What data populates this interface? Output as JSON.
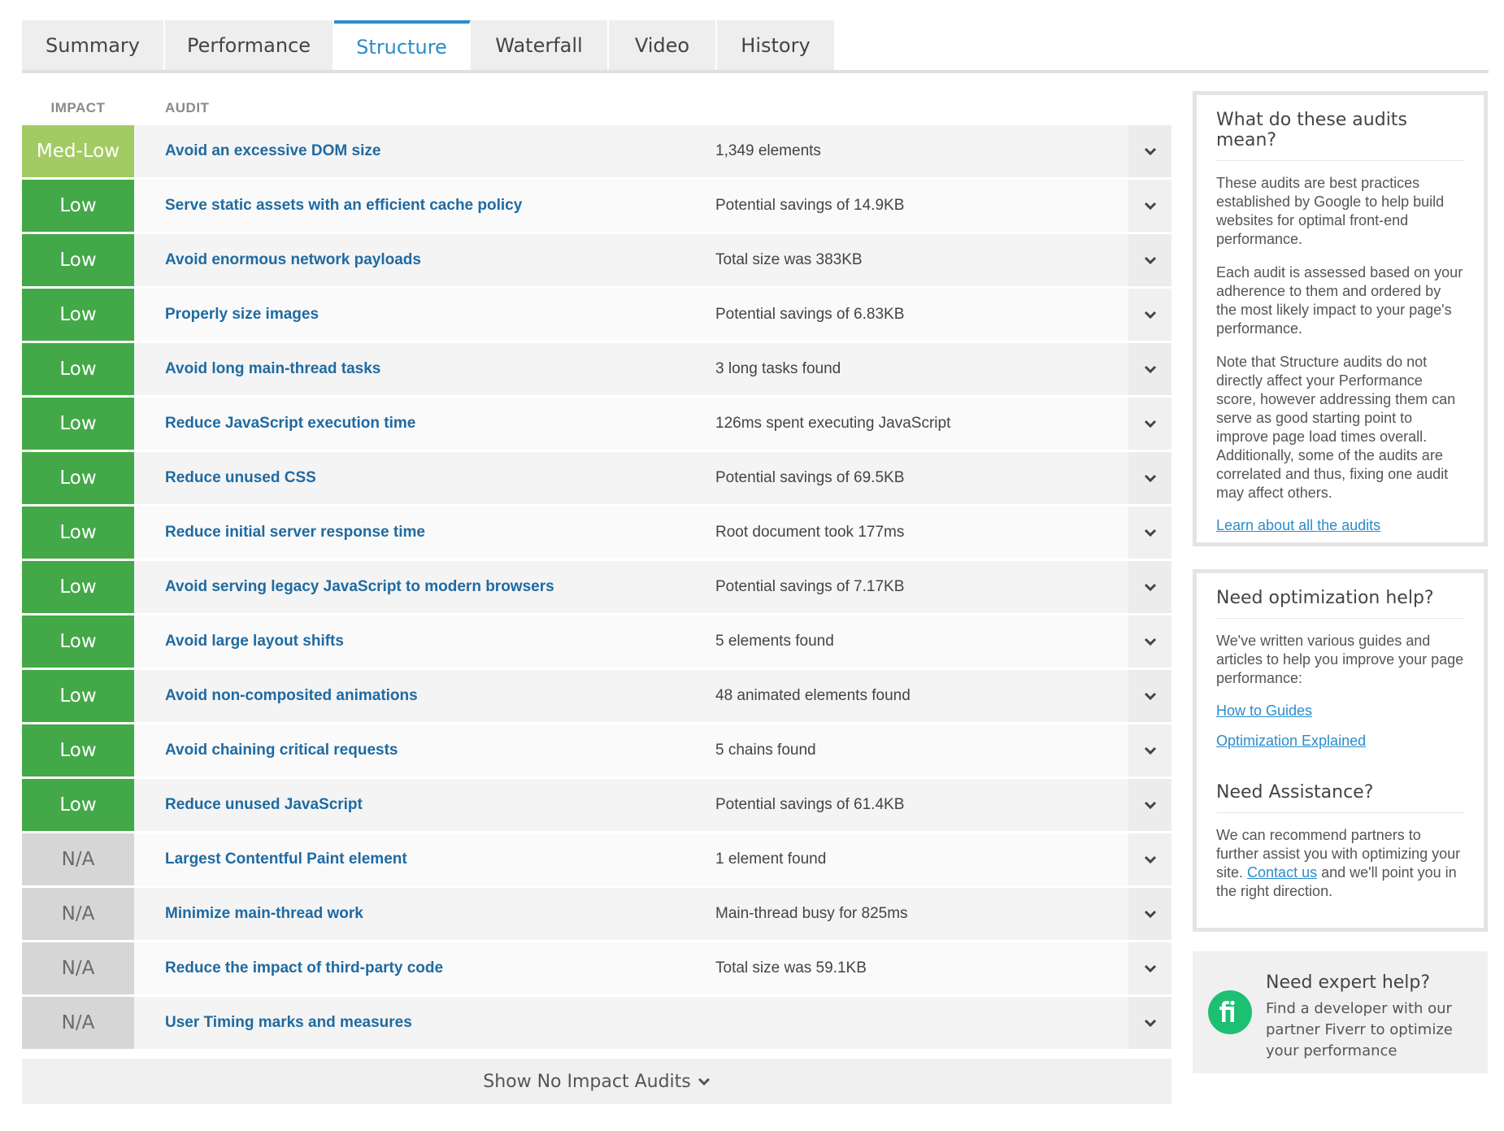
{
  "tabs": [
    {
      "label": "Summary",
      "active": false
    },
    {
      "label": "Performance",
      "active": false
    },
    {
      "label": "Structure",
      "active": true
    },
    {
      "label": "Waterfall",
      "active": false
    },
    {
      "label": "Video",
      "active": false
    },
    {
      "label": "History",
      "active": false
    }
  ],
  "table": {
    "headers": {
      "impact": "IMPACT",
      "audit": "AUDIT"
    },
    "rows": [
      {
        "impact": "Med-Low",
        "level": "med-low",
        "audit": "Avoid an excessive DOM size",
        "detail": "1,349 elements"
      },
      {
        "impact": "Low",
        "level": "low",
        "audit": "Serve static assets with an efficient cache policy",
        "detail": "Potential savings of 14.9KB"
      },
      {
        "impact": "Low",
        "level": "low",
        "audit": "Avoid enormous network payloads",
        "detail": "Total size was 383KB"
      },
      {
        "impact": "Low",
        "level": "low",
        "audit": "Properly size images",
        "detail": "Potential savings of 6.83KB"
      },
      {
        "impact": "Low",
        "level": "low",
        "audit": "Avoid long main-thread tasks",
        "detail": "3 long tasks found"
      },
      {
        "impact": "Low",
        "level": "low",
        "audit": "Reduce JavaScript execution time",
        "detail": "126ms spent executing JavaScript"
      },
      {
        "impact": "Low",
        "level": "low",
        "audit": "Reduce unused CSS",
        "detail": "Potential savings of 69.5KB"
      },
      {
        "impact": "Low",
        "level": "low",
        "audit": "Reduce initial server response time",
        "detail": "Root document took 177ms"
      },
      {
        "impact": "Low",
        "level": "low",
        "audit": "Avoid serving legacy JavaScript to modern browsers",
        "detail": "Potential savings of 7.17KB"
      },
      {
        "impact": "Low",
        "level": "low",
        "audit": "Avoid large layout shifts",
        "detail": "5 elements found"
      },
      {
        "impact": "Low",
        "level": "low",
        "audit": "Avoid non-composited animations",
        "detail": "48 animated elements found"
      },
      {
        "impact": "Low",
        "level": "low",
        "audit": "Avoid chaining critical requests",
        "detail": "5 chains found"
      },
      {
        "impact": "Low",
        "level": "low",
        "audit": "Reduce unused JavaScript",
        "detail": "Potential savings of 61.4KB"
      },
      {
        "impact": "N/A",
        "level": "na",
        "audit": "Largest Contentful Paint element",
        "detail": "1 element found"
      },
      {
        "impact": "N/A",
        "level": "na",
        "audit": "Minimize main-thread work",
        "detail": "Main-thread busy for 825ms"
      },
      {
        "impact": "N/A",
        "level": "na",
        "audit": "Reduce the impact of third-party code",
        "detail": "Total size was 59.1KB"
      },
      {
        "impact": "N/A",
        "level": "na",
        "audit": "User Timing marks and measures",
        "detail": ""
      }
    ],
    "show_more_label": "Show No Impact Audits"
  },
  "sidebar": {
    "audits_box": {
      "title": "What do these audits mean?",
      "paragraphs": [
        "These audits are best practices established by Google to help build websites for optimal front-end performance.",
        "Each audit is assessed based on your adherence to them and ordered by the most likely impact to your page's performance.",
        "Note that Structure audits do not directly affect your Performance score, however addressing them can serve as good starting point to improve page load times overall. Additionally, some of the audits are correlated and thus, fixing one audit may affect others."
      ],
      "link": "Learn about all the audits"
    },
    "help_box": {
      "title": "Need optimization help?",
      "text": "We've written various guides and articles to help you improve your page performance:",
      "links": [
        "How to Guides",
        "Optimization Explained"
      ],
      "assist_title": "Need Assistance?",
      "assist_before": "We can recommend partners to further assist you with optimizing your site.",
      "assist_link": "Contact us",
      "assist_after": "and we'll point you in the right direction."
    },
    "expert_box": {
      "title": "Need expert help?",
      "text": "Find a developer with our partner Fiverr to optimize your performance",
      "logo_text": "fi"
    }
  },
  "colors": {
    "accent": "#2b8ccc",
    "med_low": "#a3cb63",
    "low": "#43a847",
    "na": "#d6d6d6",
    "audit_link": "#1f6aa1",
    "fiverr": "#1dbf73"
  }
}
